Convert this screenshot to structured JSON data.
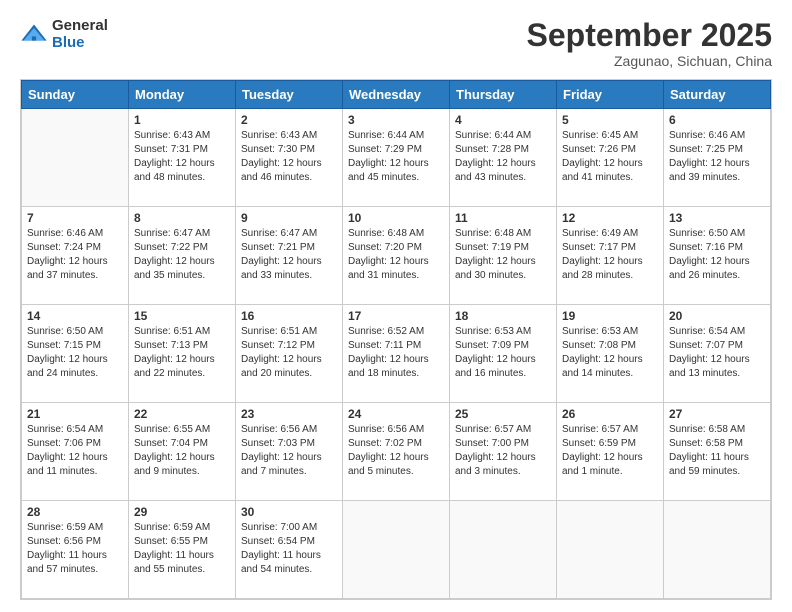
{
  "logo": {
    "general": "General",
    "blue": "Blue"
  },
  "header": {
    "month": "September 2025",
    "location": "Zagunao, Sichuan, China"
  },
  "weekdays": [
    "Sunday",
    "Monday",
    "Tuesday",
    "Wednesday",
    "Thursday",
    "Friday",
    "Saturday"
  ],
  "weeks": [
    [
      {
        "day": "",
        "info": ""
      },
      {
        "day": "1",
        "info": "Sunrise: 6:43 AM\nSunset: 7:31 PM\nDaylight: 12 hours\nand 48 minutes."
      },
      {
        "day": "2",
        "info": "Sunrise: 6:43 AM\nSunset: 7:30 PM\nDaylight: 12 hours\nand 46 minutes."
      },
      {
        "day": "3",
        "info": "Sunrise: 6:44 AM\nSunset: 7:29 PM\nDaylight: 12 hours\nand 45 minutes."
      },
      {
        "day": "4",
        "info": "Sunrise: 6:44 AM\nSunset: 7:28 PM\nDaylight: 12 hours\nand 43 minutes."
      },
      {
        "day": "5",
        "info": "Sunrise: 6:45 AM\nSunset: 7:26 PM\nDaylight: 12 hours\nand 41 minutes."
      },
      {
        "day": "6",
        "info": "Sunrise: 6:46 AM\nSunset: 7:25 PM\nDaylight: 12 hours\nand 39 minutes."
      }
    ],
    [
      {
        "day": "7",
        "info": "Sunrise: 6:46 AM\nSunset: 7:24 PM\nDaylight: 12 hours\nand 37 minutes."
      },
      {
        "day": "8",
        "info": "Sunrise: 6:47 AM\nSunset: 7:22 PM\nDaylight: 12 hours\nand 35 minutes."
      },
      {
        "day": "9",
        "info": "Sunrise: 6:47 AM\nSunset: 7:21 PM\nDaylight: 12 hours\nand 33 minutes."
      },
      {
        "day": "10",
        "info": "Sunrise: 6:48 AM\nSunset: 7:20 PM\nDaylight: 12 hours\nand 31 minutes."
      },
      {
        "day": "11",
        "info": "Sunrise: 6:48 AM\nSunset: 7:19 PM\nDaylight: 12 hours\nand 30 minutes."
      },
      {
        "day": "12",
        "info": "Sunrise: 6:49 AM\nSunset: 7:17 PM\nDaylight: 12 hours\nand 28 minutes."
      },
      {
        "day": "13",
        "info": "Sunrise: 6:50 AM\nSunset: 7:16 PM\nDaylight: 12 hours\nand 26 minutes."
      }
    ],
    [
      {
        "day": "14",
        "info": "Sunrise: 6:50 AM\nSunset: 7:15 PM\nDaylight: 12 hours\nand 24 minutes."
      },
      {
        "day": "15",
        "info": "Sunrise: 6:51 AM\nSunset: 7:13 PM\nDaylight: 12 hours\nand 22 minutes."
      },
      {
        "day": "16",
        "info": "Sunrise: 6:51 AM\nSunset: 7:12 PM\nDaylight: 12 hours\nand 20 minutes."
      },
      {
        "day": "17",
        "info": "Sunrise: 6:52 AM\nSunset: 7:11 PM\nDaylight: 12 hours\nand 18 minutes."
      },
      {
        "day": "18",
        "info": "Sunrise: 6:53 AM\nSunset: 7:09 PM\nDaylight: 12 hours\nand 16 minutes."
      },
      {
        "day": "19",
        "info": "Sunrise: 6:53 AM\nSunset: 7:08 PM\nDaylight: 12 hours\nand 14 minutes."
      },
      {
        "day": "20",
        "info": "Sunrise: 6:54 AM\nSunset: 7:07 PM\nDaylight: 12 hours\nand 13 minutes."
      }
    ],
    [
      {
        "day": "21",
        "info": "Sunrise: 6:54 AM\nSunset: 7:06 PM\nDaylight: 12 hours\nand 11 minutes."
      },
      {
        "day": "22",
        "info": "Sunrise: 6:55 AM\nSunset: 7:04 PM\nDaylight: 12 hours\nand 9 minutes."
      },
      {
        "day": "23",
        "info": "Sunrise: 6:56 AM\nSunset: 7:03 PM\nDaylight: 12 hours\nand 7 minutes."
      },
      {
        "day": "24",
        "info": "Sunrise: 6:56 AM\nSunset: 7:02 PM\nDaylight: 12 hours\nand 5 minutes."
      },
      {
        "day": "25",
        "info": "Sunrise: 6:57 AM\nSunset: 7:00 PM\nDaylight: 12 hours\nand 3 minutes."
      },
      {
        "day": "26",
        "info": "Sunrise: 6:57 AM\nSunset: 6:59 PM\nDaylight: 12 hours\nand 1 minute."
      },
      {
        "day": "27",
        "info": "Sunrise: 6:58 AM\nSunset: 6:58 PM\nDaylight: 11 hours\nand 59 minutes."
      }
    ],
    [
      {
        "day": "28",
        "info": "Sunrise: 6:59 AM\nSunset: 6:56 PM\nDaylight: 11 hours\nand 57 minutes."
      },
      {
        "day": "29",
        "info": "Sunrise: 6:59 AM\nSunset: 6:55 PM\nDaylight: 11 hours\nand 55 minutes."
      },
      {
        "day": "30",
        "info": "Sunrise: 7:00 AM\nSunset: 6:54 PM\nDaylight: 11 hours\nand 54 minutes."
      },
      {
        "day": "",
        "info": ""
      },
      {
        "day": "",
        "info": ""
      },
      {
        "day": "",
        "info": ""
      },
      {
        "day": "",
        "info": ""
      }
    ]
  ]
}
